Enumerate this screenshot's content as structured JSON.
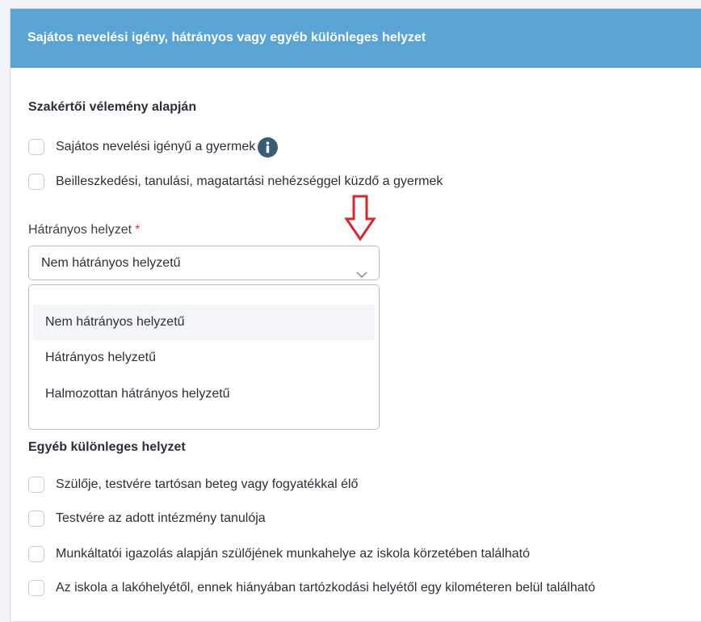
{
  "panel": {
    "header_title": "Sajátos nevelési igény, hátrányos vagy egyéb különleges helyzet"
  },
  "expert_section": {
    "title": "Szakértői vélemény alapján",
    "checkboxes": [
      {
        "label": "Sajátos nevelési igényű a gyermek",
        "checked": false,
        "has_info_icon": true
      },
      {
        "label": "Beilleszkedési, tanulási, magatartási nehézséggel küzdő a gyermek",
        "checked": false
      }
    ],
    "info_icon": "info-circle-icon"
  },
  "disadvantage_field": {
    "label": "Hátrányos helyzet",
    "required_mark": "*",
    "selected_value": "Nem hátrányos helyzetű",
    "options": [
      {
        "label": "Nem hátrányos helyzetű",
        "highlighted": true
      },
      {
        "label": "Hátrányos helyzetű",
        "highlighted": false
      },
      {
        "label": "Halmozottan hátrányos helyzetű",
        "highlighted": false
      }
    ],
    "annotation": "red-down-arrow-icon"
  },
  "other_section": {
    "title": "Egyéb különleges helyzet",
    "checkboxes": [
      {
        "label": "Szülője, testvére tartósan beteg vagy fogyatékkal élő",
        "checked": false
      },
      {
        "label": "Testvére az adott intézmény tanulója",
        "checked": false
      },
      {
        "label": "Munkáltatói igazolás alapján szülőjének munkahelye az iskola körzetében található",
        "checked": false
      },
      {
        "label": "Az iskola a lakóhelyétől, ennek hiányában tartózkodási helyétől egy kilométeren belül található",
        "checked": false
      }
    ]
  },
  "colors": {
    "header_bg": "#5aa3d5",
    "info_icon_bg": "#395e73",
    "required_star": "#d93c3c",
    "annotation_arrow": "#d9262e",
    "option_highlight": "#f3f5f8"
  }
}
